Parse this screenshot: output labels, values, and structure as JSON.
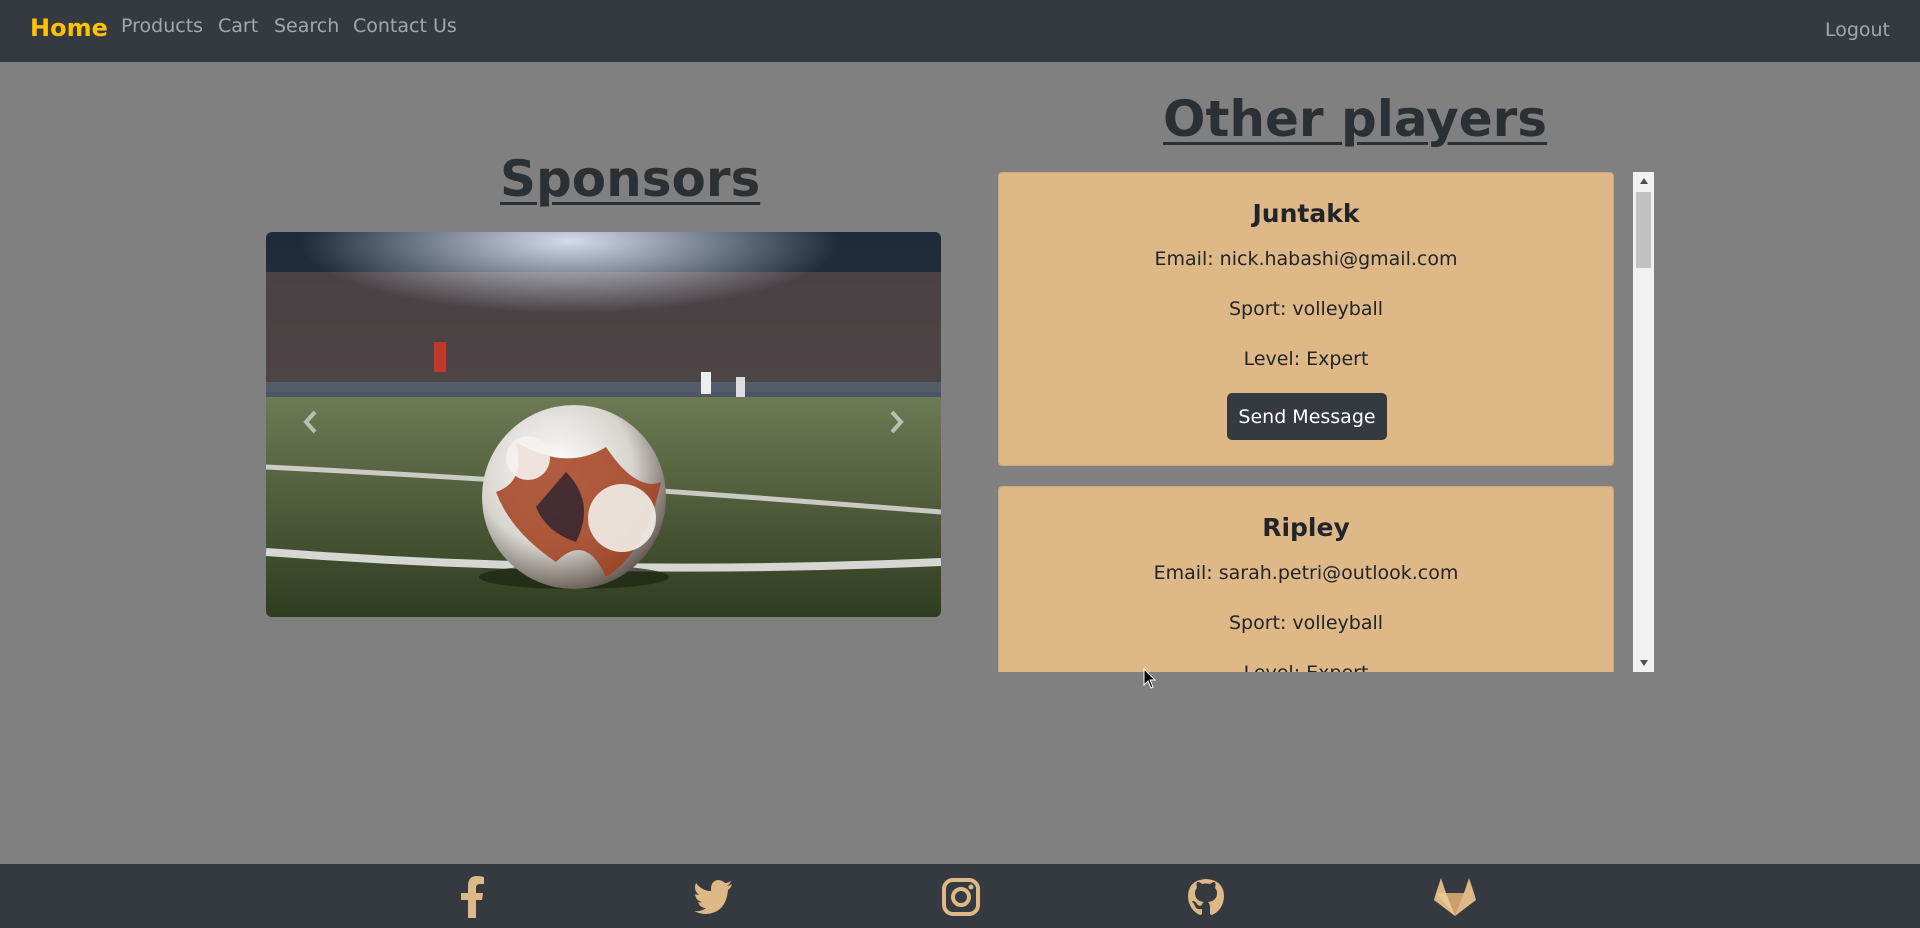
{
  "nav": {
    "brand": "Home",
    "links": [
      "Products",
      "Cart",
      "Search",
      "Contact Us"
    ],
    "logout": "Logout"
  },
  "sponsors": {
    "title": "Sponsors"
  },
  "players": {
    "title": "Other players",
    "button_label": "Send Message",
    "list": [
      {
        "name": "Juntakk",
        "email": "Email: nick.habashi@gmail.com",
        "sport": "Sport: volleyball",
        "level": "Level: Expert"
      },
      {
        "name": "Ripley",
        "email": "Email: sarah.petri@outlook.com",
        "sport": "Sport: volleyball",
        "level": "Level: Expert"
      }
    ]
  },
  "footer": {
    "icons": [
      "facebook-icon",
      "twitter-icon",
      "instagram-icon",
      "github-icon",
      "gitlab-icon"
    ]
  },
  "colors": {
    "navbar": "#343a40",
    "brand": "#ffc107",
    "background": "#808080",
    "card": "#deb887",
    "footer_icon": "#deb887"
  }
}
